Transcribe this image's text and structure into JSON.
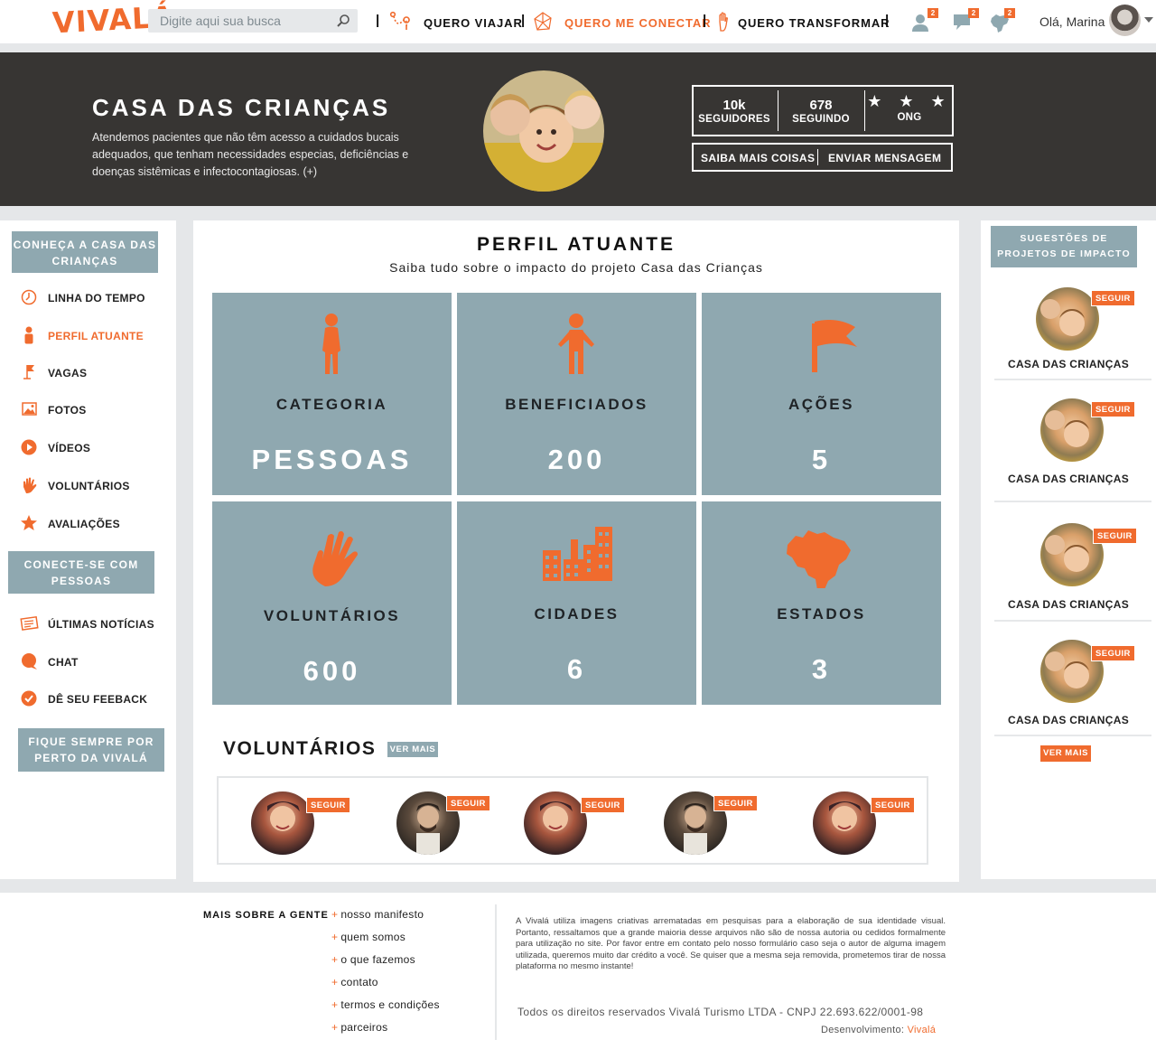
{
  "brand": {
    "logo": "VIVALÁ",
    "accent_color": "#f06b2e",
    "panel_color": "#8fa8b0",
    "hero_bg": "#373533"
  },
  "topnav": {
    "search_placeholder": "Digite aqui sua busca",
    "links": [
      {
        "label": "QUERO VIAJAR",
        "icon": "route-icon",
        "active": false
      },
      {
        "label": "QUERO ME CONECTAR",
        "icon": "network-icon",
        "active": true
      },
      {
        "label": "QUERO TRANSFORMAR",
        "icon": "hand-icon",
        "active": false
      }
    ],
    "notifications": [
      {
        "icon": "user-icon",
        "count": "2"
      },
      {
        "icon": "chat-icon",
        "count": "2"
      },
      {
        "icon": "brazil-map-icon",
        "count": "2"
      }
    ],
    "greeting": "Olá, Marina"
  },
  "hero": {
    "title": "CASA DAS CRIANÇAS",
    "description": "Atendemos pacientes que não têm acesso a cuidados bucais adequados, que tenham necessidades especias, deficiências e doenças sistêmicas e infectocontagiosas. (+)",
    "stats": [
      {
        "value": "10k",
        "label": "SEGUIDORES"
      },
      {
        "value": "678",
        "label": "SEGUINDO"
      },
      {
        "value": "★ ★ ★",
        "label": "ONG"
      }
    ],
    "buttons": [
      "SAIBA MAIS COISAS",
      "ENVIAR MENSAGEM"
    ]
  },
  "left_sidebar": {
    "heading1": "CONHEÇA A CASA DAS CRIANÇAS",
    "items1": [
      {
        "label": "LINHA DO TEMPO",
        "icon": "clock-icon",
        "active": false
      },
      {
        "label": "PERFIL ATUANTE",
        "icon": "person-icon",
        "active": true
      },
      {
        "label": "VAGAS",
        "icon": "flag-icon",
        "active": false
      },
      {
        "label": "FOTOS",
        "icon": "image-icon",
        "active": false
      },
      {
        "label": "VÍDEOS",
        "icon": "play-icon",
        "active": false
      },
      {
        "label": "VOLUNTÁRIOS",
        "icon": "hand-icon",
        "active": false
      },
      {
        "label": "AVALIAÇÕES",
        "icon": "star-icon",
        "active": false
      }
    ],
    "heading2": "CONECTE-SE COM PESSOAS",
    "items2": [
      {
        "label": "ÚLTIMAS NOTÍCIAS",
        "icon": "newspaper-icon"
      },
      {
        "label": "CHAT",
        "icon": "chat-bubble-icon"
      },
      {
        "label": "DÊ SEU FEEBACK",
        "icon": "check-circle-icon"
      }
    ],
    "heading3": "FIQUE SEMPRE POR PERTO DA VIVALÁ"
  },
  "main": {
    "title": "PERFIL ATUANTE",
    "subtitle": "Saiba tudo sobre o impacto do projeto Casa das Crianças",
    "tiles": [
      {
        "label": "CATEGORIA",
        "value": "PESSOAS",
        "icon": "woman-icon"
      },
      {
        "label": "BENEFICIADOS",
        "value": "200",
        "icon": "person-icon"
      },
      {
        "label": "AÇÕES",
        "value": "5",
        "icon": "flag-icon"
      },
      {
        "label": "VOLUNTÁRIOS",
        "value": "600",
        "icon": "hand-icon"
      },
      {
        "label": "CIDADES",
        "value": "6",
        "icon": "buildings-icon"
      },
      {
        "label": "ESTADOS",
        "value": "3",
        "icon": "brazil-map-icon"
      }
    ],
    "volunteers_title": "VOLUNTÁRIOS",
    "ver_mais": "VER MAIS",
    "seguir": "SEGUIR"
  },
  "right_sidebar": {
    "heading": "SUGESTÕES DE PROJETOS DE IMPACTO",
    "projects": [
      "CASA DAS CRIANÇAS",
      "CASA DAS CRIANÇAS",
      "CASA DAS CRIANÇAS",
      "CASA DAS CRIANÇAS"
    ],
    "seguir": "SEGUIR",
    "ver_mais": "VER MAIS"
  },
  "footer": {
    "heading": "MAIS SOBRE A GENTE",
    "links": [
      "nosso manifesto",
      "quem somos",
      "o que fazemos",
      "contato",
      "termos e condições",
      "parceiros"
    ],
    "note": "A Vivalá utiliza imagens criativas arrematadas em pesquisas para a elaboração de sua identidade visual. Portanto, ressaltamos que a grande maioria desse arquivos não são de nossa autoria ou cedidos formalmente para utilização no site. Por favor entre em contato pelo nosso formulário caso seja o autor de alguma imagem utilizada, queremos muito dar crédito a você. Se quiser que a mesma seja removida, prometemos tirar de nossa plataforma no mesmo instante!",
    "rights": "Todos os direitos reservados Vivalá Turismo LTDA   -  CNPJ 22.693.622/0001-98",
    "dev_label": "Desenvolvimento:",
    "dev_brand": "Vivalá"
  }
}
